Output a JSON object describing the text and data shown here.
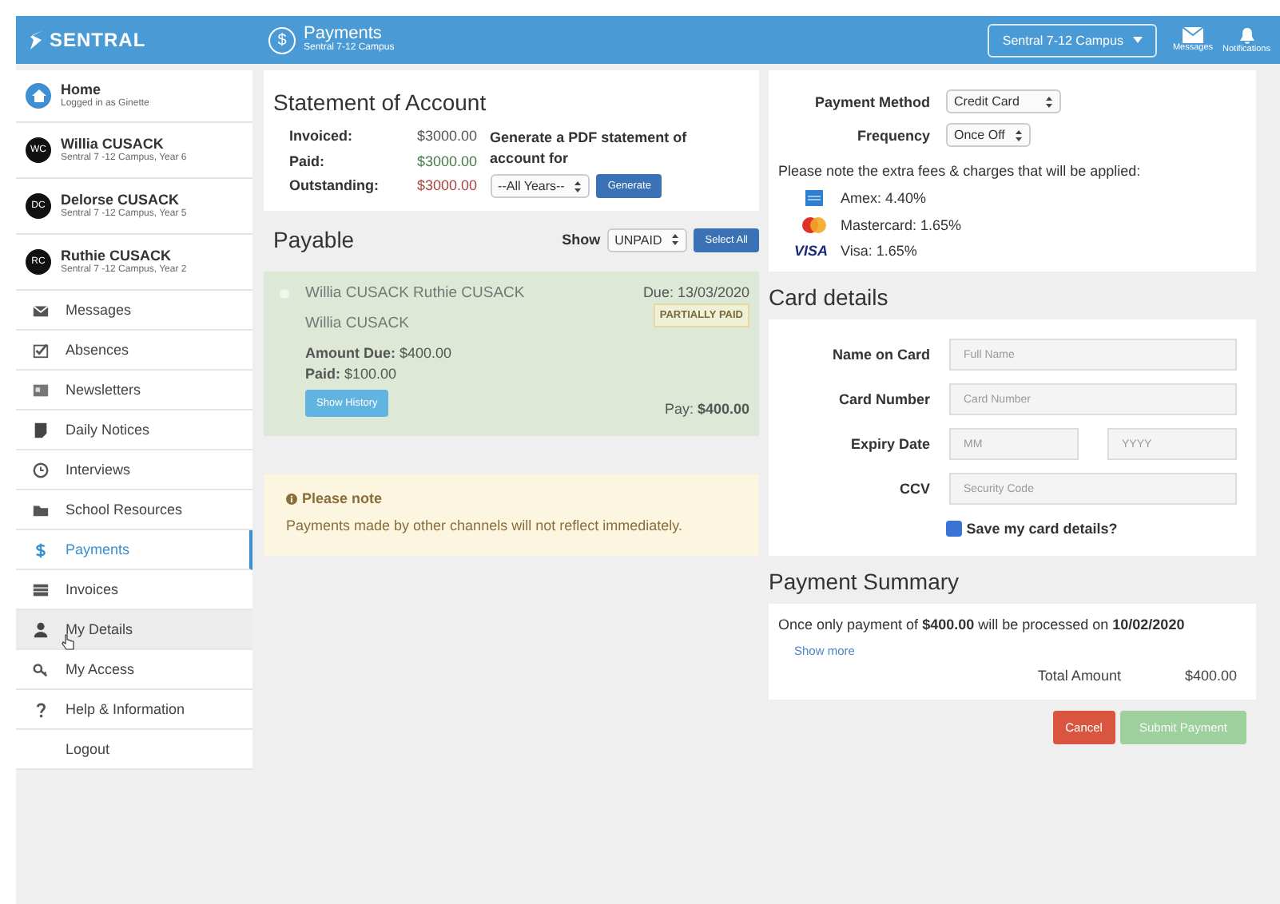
{
  "header": {
    "logo": "SENTRAL",
    "page_icon": "$",
    "title": "Payments",
    "subtitle": "Sentral 7-12 Campus",
    "campus_select": "Sentral 7-12 Campus",
    "actions": [
      {
        "label": "Messages"
      },
      {
        "label": "Notifications"
      }
    ]
  },
  "sidebar": {
    "profiles": [
      {
        "kind": "home",
        "name": "Home",
        "detail": "Logged in as Ginette"
      },
      {
        "kind": "student",
        "initials": "WC",
        "name": "Willia CUSACK",
        "detail": "Sentral 7 -12 Campus, Year 6"
      },
      {
        "kind": "student",
        "initials": "DC",
        "name": "Delorse CUSACK",
        "detail": "Sentral 7 -12 Campus, Year 5"
      },
      {
        "kind": "student",
        "initials": "RC",
        "name": "Ruthie CUSACK",
        "detail": "Sentral 7 -12 Campus, Year 2"
      }
    ],
    "menu": [
      {
        "label": "Messages",
        "selected": false,
        "hovered": false
      },
      {
        "label": "Absences",
        "selected": false,
        "hovered": false
      },
      {
        "label": "Newsletters",
        "selected": false,
        "hovered": false
      },
      {
        "label": "Daily Notices",
        "selected": false,
        "hovered": false
      },
      {
        "label": "Interviews",
        "selected": false,
        "hovered": false
      },
      {
        "label": "School Resources",
        "selected": false,
        "hovered": false
      },
      {
        "label": "Payments",
        "selected": true,
        "hovered": false
      },
      {
        "label": "Invoices",
        "selected": false,
        "hovered": false
      },
      {
        "label": "My Details",
        "selected": false,
        "hovered": true
      },
      {
        "label": "My Access",
        "selected": false,
        "hovered": false
      },
      {
        "label": "Help & Information",
        "selected": false,
        "hovered": false
      },
      {
        "label": "Logout",
        "selected": false,
        "hovered": false
      }
    ]
  },
  "statement": {
    "title": "Statement of Account",
    "rows": [
      {
        "label": "Invoiced:",
        "value": "$3000.00",
        "color": "#555555"
      },
      {
        "label": "Paid:",
        "value": "$3000.00",
        "color": "#4a7a4a"
      },
      {
        "label": "Outstanding:",
        "value": "$3000.00",
        "color": "#a94442"
      }
    ],
    "pdf_text": "Generate a PDF statement of account for",
    "year_select": "--All Years--",
    "generate_button": "Generate"
  },
  "payable": {
    "title": "Payable",
    "show_label": "Show",
    "filter": "UNPAID",
    "select_all": "Select All",
    "items": [
      {
        "checked": false,
        "names": "Willia CUSACK Ruthie CUSACK",
        "student": "Willia CUSACK",
        "due": "Due: 13/03/2020",
        "status": "PARTIALLY PAID",
        "amount_due": "**Amount Due:** $400.00",
        "paid": "**Paid:** $100.00",
        "history_button": "Show History",
        "pay": "Pay: **$400.00**"
      }
    ]
  },
  "note": {
    "title": "Please note",
    "text": "Payments made by other channels will not reflect immediately."
  },
  "payment": {
    "method_label": "Payment Method",
    "method": "Credit Card",
    "frequency_label": "Frequency",
    "frequency": "Once Off",
    "fees_note": "Please note the extra fees & charges that will be applied:",
    "fees": [
      {
        "kind": "card",
        "label": "Amex: 4.40%"
      },
      {
        "kind": "circles",
        "label": "Mastercard: 1.65%"
      },
      {
        "kind": "wordmark",
        "logo": "VISA",
        "label": "Visa: 1.65%"
      }
    ]
  },
  "card": {
    "title": "Card details",
    "fields": [
      {
        "label": "Name on Card",
        "inputs": [
          {
            "placeholder": "Full Name"
          }
        ]
      },
      {
        "label": "Card Number",
        "inputs": [
          {
            "placeholder": "Card Number"
          }
        ]
      },
      {
        "label": "Expiry Date",
        "inputs": [
          {
            "placeholder": "MM"
          },
          {
            "placeholder": "YYYY"
          }
        ]
      },
      {
        "label": "CCV",
        "inputs": [
          {
            "placeholder": "Security Code"
          }
        ]
      }
    ],
    "save": {
      "label": "Save my card details?",
      "checked": true
    }
  },
  "summary": {
    "title": "Payment Summary",
    "text": "Once only payment of **$400.00** will be processed on **10/02/2020**",
    "show_more": "Show more",
    "total_label": "Total Amount",
    "total_value": "$400.00"
  },
  "buttons": [
    {
      "kind": "cancel",
      "label": "Cancel",
      "disabled": false
    },
    {
      "kind": "submit",
      "label": "Submit Payment",
      "disabled": true
    }
  ]
}
